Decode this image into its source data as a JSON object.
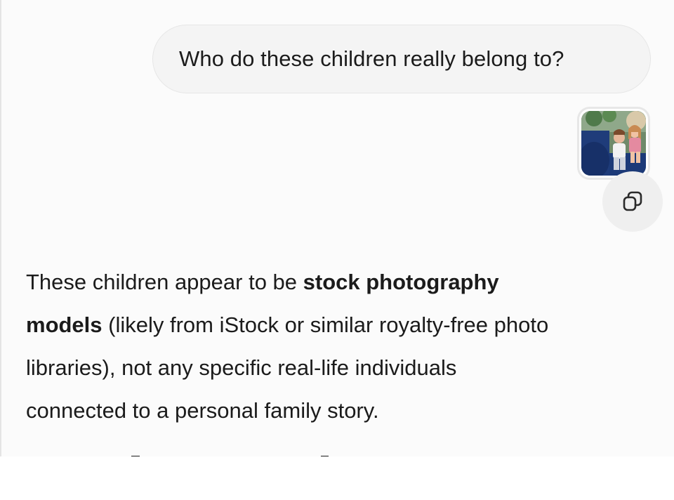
{
  "user_message": {
    "text": "Who do these children really belong to?"
  },
  "attachment": {
    "icon": "photo-thumbnail"
  },
  "actions": {
    "copy_icon": "copy-icon"
  },
  "assistant_message": {
    "line1_a": "These children appear to be ",
    "line1_b": "stock photography",
    "line2_a": "models",
    "line2_b": " (likely from iStock or similar royalty-free photo",
    "line3": "libraries), not any specific real-life individuals",
    "line4": "connected to a personal family story."
  },
  "colors": {
    "page_bg": "#fbfbfb",
    "bubble_bg": "#f4f4f4",
    "text": "#1b1b1b",
    "copy_btn_bg": "#efefef"
  }
}
